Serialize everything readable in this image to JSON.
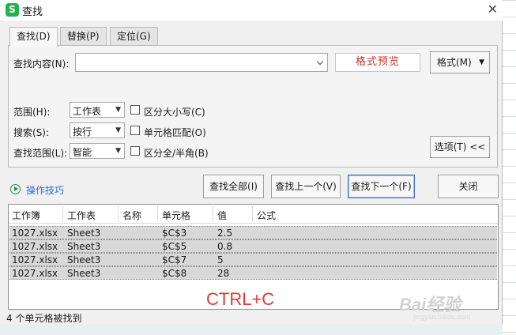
{
  "window": {
    "title": "查找",
    "app_icon": "S"
  },
  "tabs": [
    {
      "label": "查找(D)",
      "active": true
    },
    {
      "label": "替换(P)",
      "active": false
    },
    {
      "label": "定位(G)",
      "active": false
    }
  ],
  "find": {
    "content_label": "查找内容(N):",
    "content_value": "",
    "preview_label": "格式预览",
    "format_button": "格式(M)"
  },
  "options": {
    "range_label": "范围(H):",
    "range_value": "工作表",
    "search_label": "搜索(S):",
    "search_value": "按行",
    "lookin_label": "查找范围(L):",
    "lookin_value": "智能",
    "match_case_label": "区分大小写(C)",
    "match_cell_label": "单元格匹配(O)",
    "match_width_label": "区分全/半角(B)",
    "options_button": "选项(T) <<"
  },
  "actions": {
    "tips": "操作技巧",
    "find_all": "查找全部(I)",
    "find_prev": "查找上一个(V)",
    "find_next": "查找下一个(F)",
    "close": "关闭"
  },
  "results": {
    "columns": [
      "工作簿",
      "工作表",
      "名称",
      "单元格",
      "值",
      "公式"
    ],
    "rows": [
      {
        "book": "1027.xlsx",
        "sheet": "Sheet3",
        "name": "",
        "cell": "$C$3",
        "value": "2.5",
        "formula": ""
      },
      {
        "book": "1027.xlsx",
        "sheet": "Sheet3",
        "name": "",
        "cell": "$C$5",
        "value": "0.8",
        "formula": ""
      },
      {
        "book": "1027.xlsx",
        "sheet": "Sheet3",
        "name": "",
        "cell": "$C$7",
        "value": "5",
        "formula": ""
      },
      {
        "book": "1027.xlsx",
        "sheet": "Sheet3",
        "name": "",
        "cell": "$C$8",
        "value": "28",
        "formula": ""
      }
    ]
  },
  "overlay_text": "CTRL+C",
  "watermark": {
    "main": "Bai经验",
    "sub": "jingyan.baidu.com"
  },
  "status": "4 个单元格被找到",
  "colors": {
    "accent": "#2a6fd4",
    "overlay": "#e03a3a",
    "preview": "#c0392b",
    "selection": "#d8d8d8"
  }
}
